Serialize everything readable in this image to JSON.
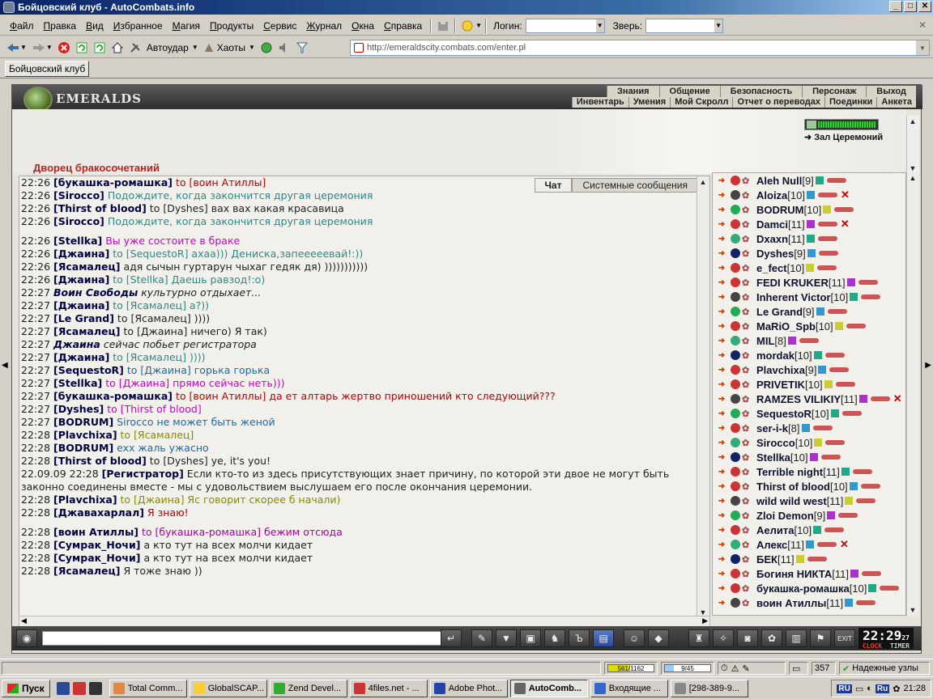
{
  "window": {
    "title": "Бойцовский клуб - AutoCombats.info"
  },
  "menu": {
    "items": [
      "Файл",
      "Правка",
      "Вид",
      "Избранное",
      "Магия",
      "Продукты",
      "Сервис",
      "Журнал",
      "Окна",
      "Справка"
    ],
    "login_label": "Логин:",
    "beast_label": "Зверь:"
  },
  "toolbar": {
    "autoudar": "Автоудар",
    "haoty": "Хаоты",
    "url": "http://emeraldscity.combats.com/enter.pl"
  },
  "tabs": [
    "Бойцовский клуб"
  ],
  "game": {
    "logo": "EMERALDS",
    "nav_top": [
      "Знания",
      "Общение",
      "Безопасность",
      "Персонаж",
      "Выход"
    ],
    "nav_bottom": [
      "Инвентарь",
      "Умения",
      "Мой Скролл",
      "Отчет о переводах",
      "Поединки",
      "Анкета"
    ],
    "location_title": "Дворец бракосочетаний",
    "room_name": "Зал Церемоний"
  },
  "chat": {
    "tabs": [
      "Чат",
      "Системные сообщения"
    ],
    "lines": [
      {
        "time": "22:26",
        "nick": "[букашка-ромашка]",
        "msg": " to [воин Атиллы]",
        "nick_color": "#004",
        "msg_color": "#b00"
      },
      {
        "time": "22:26",
        "nick": "[Sirocco]",
        "msg": " Подождите, когда закончится другая церемония",
        "nick_color": "#004",
        "msg_color": "#2a8a8a"
      },
      {
        "time": "22:26",
        "nick": "[Thirst of blood]",
        "msg": " to [Dyshes] вах вах какая красавица",
        "nick_color": "#004",
        "msg_color": "#222"
      },
      {
        "time": "22:26",
        "nick": "[Sirocco]",
        "msg": " Подождите, когда закончится другая церемония",
        "nick_color": "#004",
        "msg_color": "#2a8a8a"
      },
      {
        "gap": true
      },
      {
        "time": "22:26",
        "nick": "[Stellka]",
        "msg": " Вы уже состоите в браке",
        "nick_color": "#004",
        "msg_color": "#c0c"
      },
      {
        "time": "22:26",
        "nick": "[Джаина]",
        "msg": " to [SequestoR] ахаа))) Дениска,запееееевай!:))",
        "nick_color": "#004",
        "msg_color": "#2a8a8a"
      },
      {
        "time": "22:26",
        "nick": "[Ясамалец]",
        "msg": " адя сычын гуртарун чыхаг гедяк дя) )))))))))))",
        "nick_color": "#004",
        "msg_color": "#222"
      },
      {
        "time": "22:26",
        "nick": "[Джаина]",
        "msg": " to [Stellka] Даешь равзод!:о)",
        "nick_color": "#004",
        "msg_color": "#2a8a8a"
      },
      {
        "time": "22:27",
        "nick": "Воин Свободы",
        "msg": " культурно отдыхает...",
        "nick_color": "#004",
        "msg_color": "#222",
        "italic": true
      },
      {
        "time": "22:27",
        "nick": "[Джаина]",
        "msg": " to [Ясамалец] а?))",
        "nick_color": "#004",
        "msg_color": "#2a8a8a"
      },
      {
        "time": "22:27",
        "nick": "[Le Grand]",
        "msg": " to [Ясамалец] ))))",
        "nick_color": "#004",
        "msg_color": "#222"
      },
      {
        "time": "22:27",
        "nick": "[Ясамалец]",
        "msg": " to [Джаина] ничего) Я так)",
        "nick_color": "#004",
        "msg_color": "#222"
      },
      {
        "time": "22:27",
        "nick": "Джаина",
        "msg": " сейчас побьет регистратора",
        "nick_color": "#004",
        "msg_color": "#222",
        "italic": true
      },
      {
        "time": "22:27",
        "nick": "[Джаина]",
        "msg": " to [Ясамалец] ))))",
        "nick_color": "#004",
        "msg_color": "#2a8a8a"
      },
      {
        "time": "22:27",
        "nick": "[SequestoR]",
        "msg": " to [Джаина]   горька горька",
        "nick_color": "#004",
        "msg_color": "#1a6aa8"
      },
      {
        "time": "22:27",
        "nick": "[Stellka]",
        "msg": " to [Джаина] прямо сейчас неть)))",
        "nick_color": "#004",
        "msg_color": "#c0c"
      },
      {
        "time": "22:27",
        "nick": "[букашка-ромашка]",
        "msg": " to [воин Атиллы] да ет алтарь жертво приношений кто следующий???",
        "nick_color": "#004",
        "msg_color": "#b00"
      },
      {
        "time": "22:27",
        "nick": "[Dyshes]",
        "msg": " to [Thirst of blood]",
        "nick_color": "#004",
        "msg_color": "#c0c"
      },
      {
        "time": "22:27",
        "nick": "[BODRUM]",
        "msg": " Sirocco не может быть женой",
        "nick_color": "#004",
        "msg_color": "#1a6aa8"
      },
      {
        "time": "22:28",
        "nick": "[Plavchixa]",
        "msg": " to [Ясамалец]",
        "nick_color": "#004",
        "msg_color": "#8a8a00"
      },
      {
        "time": "22:28",
        "nick": "[BODRUM]",
        "msg": " exx жаль ужасно",
        "nick_color": "#004",
        "msg_color": "#1a6aa8"
      },
      {
        "time": "22:28",
        "nick": "[Thirst of blood]",
        "msg": " to [Dyshes] ye, it's you!",
        "nick_color": "#004",
        "msg_color": "#222"
      },
      {
        "time": "22.09.09 22:28",
        "nick": "[Регистратор]",
        "msg": " Если кто-то из здесь присутствующих знает причину, по которой эти двое не могут быть законно соединены вместе - мы с удовольствием выслушаем его после окончания церемонии.",
        "nick_color": "#004",
        "msg_color": "#222",
        "wrap": true
      },
      {
        "time": "22:28",
        "nick": "[Plavchixa]",
        "msg": " to [Джаина] Яс говорит скорее б начали)",
        "nick_color": "#004",
        "msg_color": "#8a8a00"
      },
      {
        "time": "22:28",
        "nick": "[Джавахарлал]",
        "msg": " Я знаю!",
        "nick_color": "#004",
        "msg_color": "#b00"
      },
      {
        "gap": true
      },
      {
        "time": "22:28",
        "nick": "[воин Атиллы]",
        "msg": " to [букашка-ромашка]       бежим отсюда",
        "nick_color": "#004",
        "msg_color": "#a0a"
      },
      {
        "time": "22:28",
        "nick": "[Сумрак_Ночи]",
        "msg": " а кто тут на всех молчи кидает",
        "nick_color": "#004",
        "msg_color": "#222"
      },
      {
        "time": "22:28",
        "nick": "[Сумрак_Ночи]",
        "msg": " а кто тут на всех молчи кидает",
        "nick_color": "#004",
        "msg_color": "#222"
      },
      {
        "time": "22:28",
        "nick": "[Ясамалец]",
        "msg": " Я тоже знаю ))",
        "nick_color": "#004",
        "msg_color": "#222"
      }
    ]
  },
  "users": [
    {
      "name": "Aleh Null",
      "level": "[9]"
    },
    {
      "name": "Aloiza",
      "level": "[10]",
      "x": true
    },
    {
      "name": "BODRUM",
      "level": "[10]"
    },
    {
      "name": "Damci",
      "level": "[11]",
      "x": true
    },
    {
      "name": "Dxaxn",
      "level": "[11]"
    },
    {
      "name": "Dyshes",
      "level": "[9]"
    },
    {
      "name": "e_fect",
      "level": "[10]"
    },
    {
      "name": "FEDI KRUKER",
      "level": "[11]"
    },
    {
      "name": "Inherent Victor",
      "level": "[10]"
    },
    {
      "name": "Le Grand",
      "level": "[9]"
    },
    {
      "name": "MaRiO_Spb",
      "level": "[10]"
    },
    {
      "name": "MIL",
      "level": "[8]"
    },
    {
      "name": "mordak",
      "level": "[10]"
    },
    {
      "name": "Plavchixa",
      "level": "[9]"
    },
    {
      "name": "PRIVETIK",
      "level": "[10]"
    },
    {
      "name": "RAMZES VILIKIY",
      "level": "[11]",
      "x": true
    },
    {
      "name": "SequestoR",
      "level": "[10]"
    },
    {
      "name": "ser-i-k",
      "level": "[8]"
    },
    {
      "name": "Sirocco",
      "level": "[10]"
    },
    {
      "name": "Stellka",
      "level": "[10]"
    },
    {
      "name": "Terrible night",
      "level": "[11]"
    },
    {
      "name": "Thirst of blood",
      "level": "[10]"
    },
    {
      "name": "wild wild west",
      "level": "[11]"
    },
    {
      "name": "Zloi Demon",
      "level": "[9]"
    },
    {
      "name": "Аелита",
      "level": "[10]"
    },
    {
      "name": "Алекс",
      "level": "[11]",
      "x": true
    },
    {
      "name": "БЕК",
      "level": "[11]"
    },
    {
      "name": "Богиня НИКТА",
      "level": "[11]"
    },
    {
      "name": "букашка-ромашка",
      "level": "[10]"
    },
    {
      "name": "воин Атиллы",
      "level": "[11]"
    }
  ],
  "clock": {
    "time": "22:29",
    "seconds": "27",
    "label_clock": "CLOCK",
    "label_timer": "TIMER"
  },
  "status": {
    "hp": "561/1162",
    "hp_fraction": 0.48,
    "mana": "9/45",
    "mana_fraction": 0.2,
    "count": "357",
    "trusted": "Надежные узлы",
    "exit": "EXIT"
  },
  "taskbar": {
    "start": "Пуск",
    "tasks": [
      "Total Comm...",
      "GlobalSCAP...",
      "Zend Devel...",
      "4files.net - ...",
      "Adobe Phot...",
      "AutoComb...",
      "Входящие ...",
      "[298-389-9..."
    ],
    "active": 5,
    "lang": "Ru",
    "lang2": "RU",
    "time": "21:28"
  }
}
